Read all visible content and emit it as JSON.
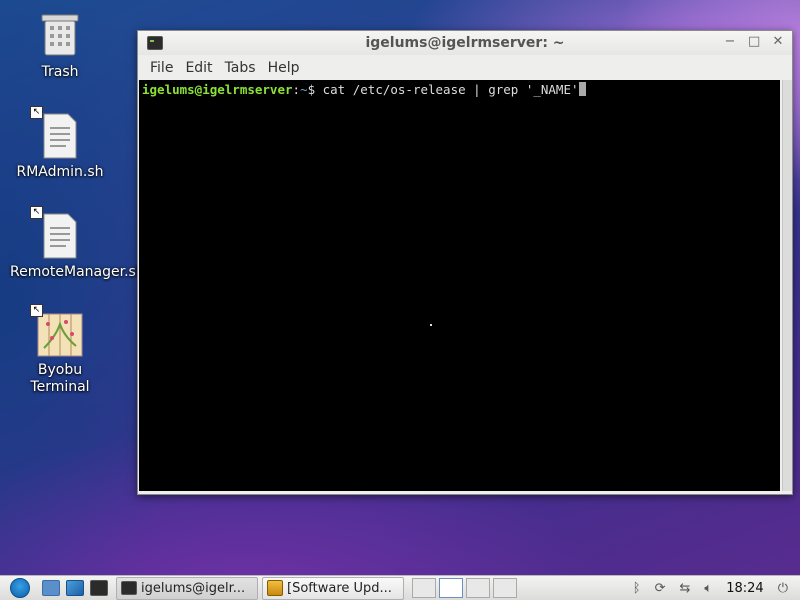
{
  "desktop": {
    "icons": [
      {
        "label": "Trash",
        "icon": "trash-icon"
      },
      {
        "label": "RMAdmin.sh",
        "icon": "script-file-icon"
      },
      {
        "label": "RemoteManager.sh",
        "icon": "script-file-icon"
      },
      {
        "label": "Byobu Terminal",
        "icon": "byobu-icon"
      }
    ]
  },
  "window": {
    "title": "igelums@igelrmserver: ~",
    "controls": {
      "minimize": "−",
      "maximize": "□",
      "close": "✕"
    },
    "menu": [
      "File",
      "Edit",
      "Tabs",
      "Help"
    ],
    "terminal": {
      "user_host": "igelums@igelrmserver",
      "separator": ":",
      "path": "~",
      "prompt_symbol": "$",
      "command": " cat /etc/os-release | grep '_NAME'"
    }
  },
  "taskbar": {
    "tasks": [
      {
        "label": "igelums@igelr...",
        "icon": "terminal-icon",
        "active": true
      },
      {
        "label": "[Software Upd...",
        "icon": "package-icon",
        "active": false
      }
    ],
    "clock": "18:24",
    "tray_icons": [
      "bluetooth-icon",
      "update-icon",
      "network-icon",
      "volume-icon",
      "power-icon"
    ]
  },
  "colors": {
    "prompt_user": "#8ae234",
    "prompt_path": "#729fcf",
    "terminal_bg": "#000000"
  }
}
